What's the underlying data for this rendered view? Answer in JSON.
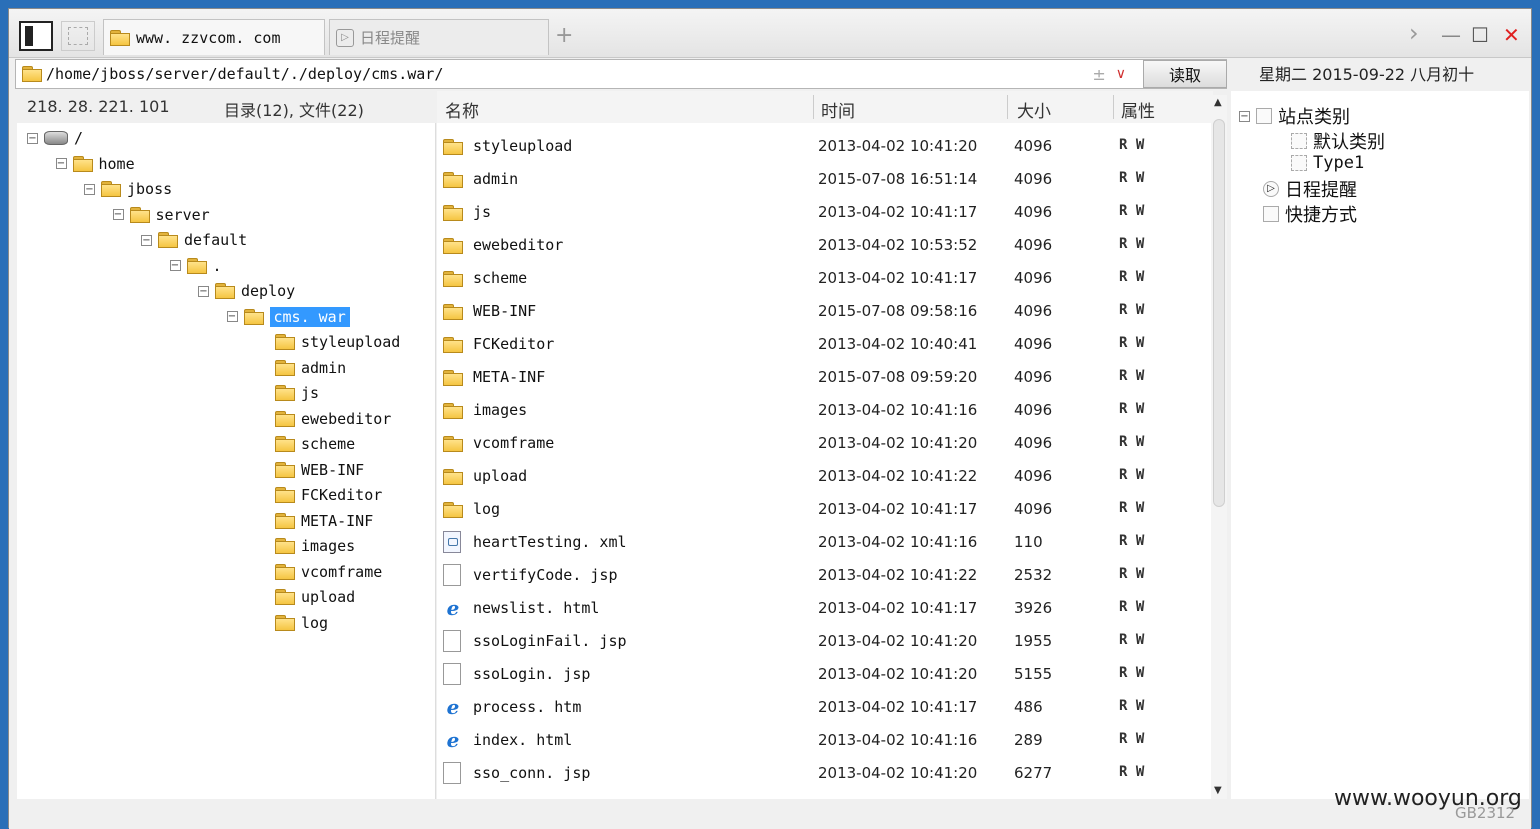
{
  "tabs": [
    {
      "label": "www. zzvcom. com",
      "active": true
    },
    {
      "label": "日程提醒",
      "active": false
    }
  ],
  "tabbar": {
    "add_label": "+"
  },
  "window_controls": {
    "forward": "›",
    "minimize": "—",
    "maximize": "☐",
    "close": "✕"
  },
  "address": {
    "value": "/home/jboss/server/default/./deploy/cms.war/",
    "read_label": "读取"
  },
  "date": "星期二 2015-09-22 八月初十",
  "ip": "218. 28. 221. 101",
  "dir_summary": "目录(12), 文件(22)",
  "columns": {
    "name": "名称",
    "time": "时间",
    "size": "大小",
    "attr": "属性"
  },
  "tree": [
    {
      "label": "/",
      "level": 0,
      "type": "drive"
    },
    {
      "label": "home",
      "level": 1,
      "type": "folder"
    },
    {
      "label": "jboss",
      "level": 2,
      "type": "folder"
    },
    {
      "label": "server",
      "level": 3,
      "type": "folder"
    },
    {
      "label": "default",
      "level": 4,
      "type": "folder"
    },
    {
      "label": ".",
      "level": 5,
      "type": "folder"
    },
    {
      "label": "deploy",
      "level": 6,
      "type": "folder"
    },
    {
      "label": "cms. war",
      "level": 7,
      "type": "folder",
      "selected": true
    },
    {
      "label": "styleupload",
      "level": 8,
      "type": "folder"
    },
    {
      "label": "admin",
      "level": 8,
      "type": "folder"
    },
    {
      "label": "js",
      "level": 8,
      "type": "folder"
    },
    {
      "label": "ewebeditor",
      "level": 8,
      "type": "folder"
    },
    {
      "label": "scheme",
      "level": 8,
      "type": "folder"
    },
    {
      "label": "WEB-INF",
      "level": 8,
      "type": "folder"
    },
    {
      "label": "FCKeditor",
      "level": 8,
      "type": "folder"
    },
    {
      "label": "META-INF",
      "level": 8,
      "type": "folder"
    },
    {
      "label": "images",
      "level": 8,
      "type": "folder"
    },
    {
      "label": "vcomframe",
      "level": 8,
      "type": "folder"
    },
    {
      "label": "upload",
      "level": 8,
      "type": "folder"
    },
    {
      "label": "log",
      "level": 8,
      "type": "folder"
    }
  ],
  "files": [
    {
      "name": "styleupload",
      "time": "2013-04-02 10:41:20",
      "size": "4096",
      "attr": "R W",
      "type": "folder"
    },
    {
      "name": "admin",
      "time": "2015-07-08 16:51:14",
      "size": "4096",
      "attr": "R W",
      "type": "folder"
    },
    {
      "name": "js",
      "time": "2013-04-02 10:41:17",
      "size": "4096",
      "attr": "R W",
      "type": "folder"
    },
    {
      "name": "ewebeditor",
      "time": "2013-04-02 10:53:52",
      "size": "4096",
      "attr": "R W",
      "type": "folder"
    },
    {
      "name": "scheme",
      "time": "2013-04-02 10:41:17",
      "size": "4096",
      "attr": "R W",
      "type": "folder"
    },
    {
      "name": "WEB-INF",
      "time": "2015-07-08 09:58:16",
      "size": "4096",
      "attr": "R W",
      "type": "folder"
    },
    {
      "name": "FCKeditor",
      "time": "2013-04-02 10:40:41",
      "size": "4096",
      "attr": "R W",
      "type": "folder"
    },
    {
      "name": "META-INF",
      "time": "2015-07-08 09:59:20",
      "size": "4096",
      "attr": "R W",
      "type": "folder"
    },
    {
      "name": "images",
      "time": "2013-04-02 10:41:16",
      "size": "4096",
      "attr": "R W",
      "type": "folder"
    },
    {
      "name": "vcomframe",
      "time": "2013-04-02 10:41:20",
      "size": "4096",
      "attr": "R W",
      "type": "folder"
    },
    {
      "name": "upload",
      "time": "2013-04-02 10:41:22",
      "size": "4096",
      "attr": "R W",
      "type": "folder"
    },
    {
      "name": "log",
      "time": "2013-04-02 10:41:17",
      "size": "4096",
      "attr": "R W",
      "type": "folder"
    },
    {
      "name": "heartTesting. xml",
      "time": "2013-04-02 10:41:16",
      "size": "110",
      "attr": "R W",
      "type": "xml"
    },
    {
      "name": "vertifyCode. jsp",
      "time": "2013-04-02 10:41:22",
      "size": "2532",
      "attr": "R W",
      "type": "doc"
    },
    {
      "name": "newslist. html",
      "time": "2013-04-02 10:41:17",
      "size": "3926",
      "attr": "R W",
      "type": "ie"
    },
    {
      "name": "ssoLoginFail. jsp",
      "time": "2013-04-02 10:41:20",
      "size": "1955",
      "attr": "R W",
      "type": "doc"
    },
    {
      "name": "ssoLogin. jsp",
      "time": "2013-04-02 10:41:20",
      "size": "5155",
      "attr": "R W",
      "type": "doc"
    },
    {
      "name": "process. htm",
      "time": "2013-04-02 10:41:17",
      "size": "486",
      "attr": "R W",
      "type": "ie"
    },
    {
      "name": "index. html",
      "time": "2013-04-02 10:41:16",
      "size": "289",
      "attr": "R W",
      "type": "ie"
    },
    {
      "name": "sso_conn. jsp",
      "time": "2013-04-02 10:41:20",
      "size": "6277",
      "attr": "R W",
      "type": "doc"
    }
  ],
  "right_tree": {
    "root": "站点类别",
    "children": [
      "默认类别",
      "Type1"
    ],
    "others": [
      "日程提醒",
      "快捷方式"
    ]
  },
  "watermark": "www.wooyun.org",
  "encoding": "GB2312",
  "colors": {
    "selection": "#3399ff",
    "folder": "#f5c542",
    "close": "#e02020",
    "desktop": "#2a6fb8"
  },
  "icons": {
    "tab_folder": "folder-icon",
    "drive": "drive-icon",
    "html": "ie-icon",
    "xml": "xml-file-icon"
  }
}
